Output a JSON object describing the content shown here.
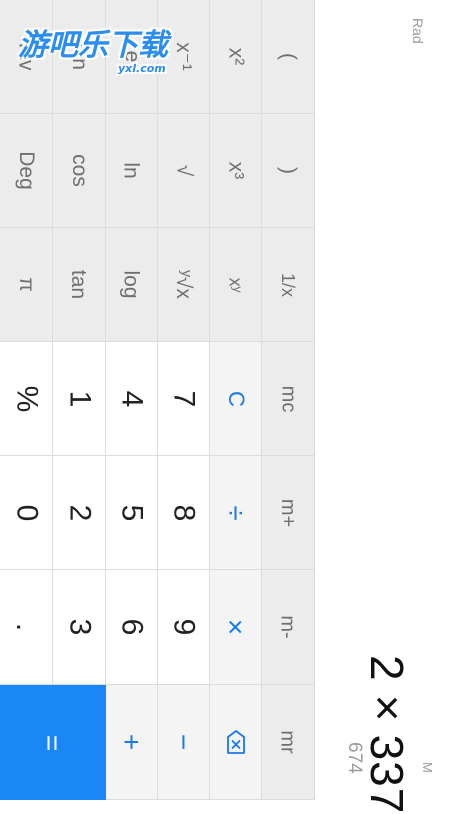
{
  "display": {
    "angle_mode": "Rad",
    "memory_indicator": "M",
    "expression": "2×337",
    "result": "674"
  },
  "watermark": {
    "text": "游吧乐下载",
    "sub": "yxl.com"
  },
  "keys": {
    "inv": "Inv",
    "sin": "sin",
    "e": "e",
    "xinv": "x⁻¹",
    "x2": "x²",
    "lparen": "(",
    "deg": "Deg",
    "cos": "cos",
    "ln": "ln",
    "sqrt": "√",
    "x3": "x³",
    "rparen": ")",
    "pi": "π",
    "tan": "tan",
    "log": "log",
    "ysqrtx": "ʸ√x",
    "xy": "xʸ",
    "recip": "1/x",
    "percent": "%",
    "one": "1",
    "four": "4",
    "seven": "7",
    "clear": "C",
    "mc": "mc",
    "zero": "0",
    "two": "2",
    "five": "5",
    "eight": "8",
    "divide": "÷",
    "mplus": "m+",
    "dot": ".",
    "three": "3",
    "six": "6",
    "nine": "9",
    "multiply": "×",
    "mminus": "m-",
    "equals": "=",
    "plus": "+",
    "minus": "−",
    "mr": "mr"
  },
  "icons": {
    "backspace": "backspace-icon"
  }
}
